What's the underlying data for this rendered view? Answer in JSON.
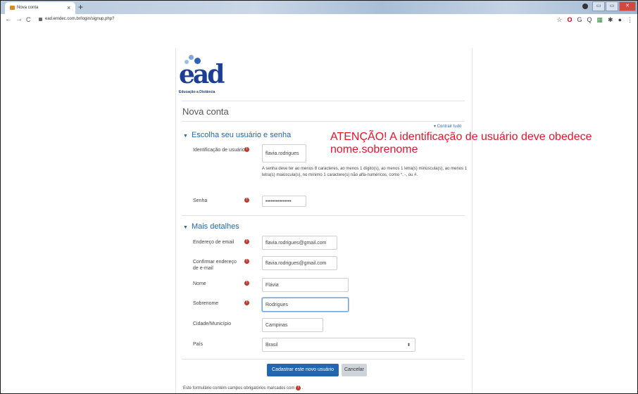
{
  "browser": {
    "tab_title": "Nova conta",
    "tab_close": "×",
    "new_tab": "+",
    "url": "ead.emdec.com.br/login/signup.php?",
    "back": "←",
    "forward": "→",
    "reload": "C",
    "win_min": "▭",
    "win_max": "▭",
    "win_close": "✕",
    "ext_icons": [
      "☆",
      "O",
      "G",
      "Q",
      "▦",
      "✱",
      "●",
      "⋮"
    ]
  },
  "logo": {
    "word": "ead",
    "tagline": "Educação a Distância"
  },
  "page": {
    "title": "Nova conta",
    "collapse_all": "▾ Contrair tudo"
  },
  "section_account": {
    "title": "Escolha seu usuário e senha",
    "caret": "▼",
    "username_label": "Identificação de usuário",
    "username_value": "flavia.rodrigues",
    "password_help": "A senha deve ter ao menos 8 caracteres, ao menos 1 dígito(s), ao menos 1 letra(s) minúscula(s), ao menos 1 letra(s) maiúscula(s), no mínimo 1 caractere(s) não alfa-numéricos, como *, -, ou #.",
    "password_label": "Senha",
    "password_value": "•••••••••••••••"
  },
  "section_details": {
    "title": "Mais detalhes",
    "caret": "▼",
    "email_label": "Endereço de email",
    "email_value": "flavia.rodrigues@gmail.com",
    "email_confirm_label": "Confirmar endereço de e-mail",
    "email_confirm_value": "flavia.rodrigues@gmail.com",
    "name_label": "Nome",
    "name_value": "Flávia",
    "surname_label": "Sobrenome",
    "surname_value": "Rodrigues",
    "city_label": "Cidade/Município",
    "city_value": "Campinas",
    "country_label": "País",
    "country_value": "Brasil",
    "country_arrow": "⬍"
  },
  "buttons": {
    "submit": "Cadastrar este novo usuário",
    "cancel": "Cancelar"
  },
  "footnote": {
    "text": "Este formulário contém campos obrigatórios marcados com",
    "icon": "!",
    "suffix": "."
  },
  "required_icon": "!",
  "alert": {
    "line1": "ATENÇÃO! A identificação de usuário deve obedece",
    "line2": "nome.sobrenome"
  },
  "colors": {
    "accent": "#1f67b3",
    "required": "#c0392b",
    "alert": "#e8142a"
  }
}
